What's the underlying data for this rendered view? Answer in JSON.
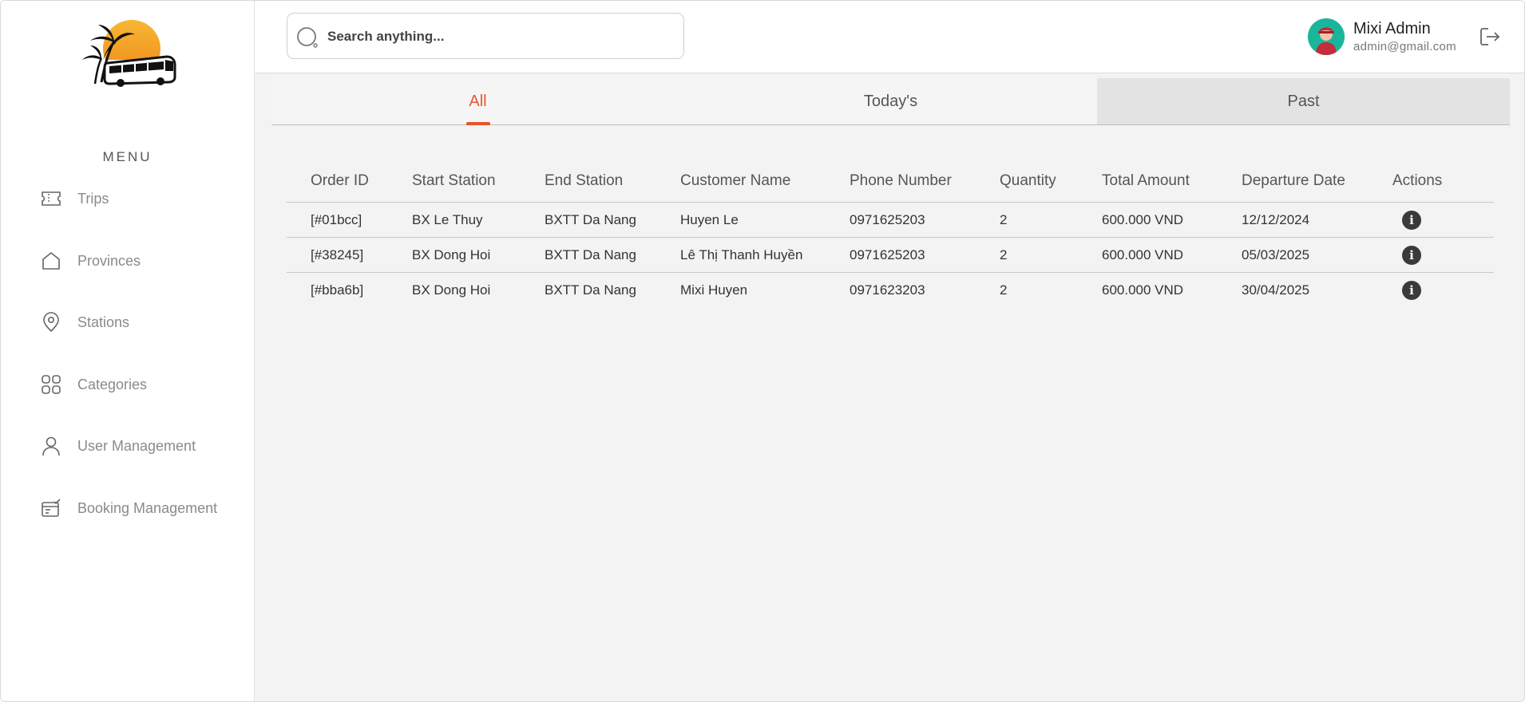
{
  "sidebar": {
    "menu_title": "MENU",
    "items": [
      {
        "label": "Trips",
        "icon": "ticket-icon"
      },
      {
        "label": "Provinces",
        "icon": "home-icon"
      },
      {
        "label": "Stations",
        "icon": "location-pin-icon"
      },
      {
        "label": "Categories",
        "icon": "grid-icon"
      },
      {
        "label": "User Management",
        "icon": "user-icon"
      },
      {
        "label": "Booking Management",
        "icon": "booking-icon"
      }
    ]
  },
  "header": {
    "search_placeholder": "Search anything...",
    "user_name": "Mixi Admin",
    "user_email": "admin@gmail.com"
  },
  "tabs": [
    {
      "label": "All",
      "active": true
    },
    {
      "label": "Today's",
      "active": false
    },
    {
      "label": "Past",
      "active": false
    }
  ],
  "table": {
    "columns": [
      "Order ID",
      "Start Station",
      "End Station",
      "Customer Name",
      "Phone Number",
      "Quantity",
      "Total Amount",
      "Departure Date",
      "Actions"
    ],
    "rows": [
      [
        "[#01bcc]",
        "BX Le Thuy",
        "BXTT Da Nang",
        "Huyen Le",
        "0971625203",
        "2",
        "600.000 VND",
        "12/12/2024"
      ],
      [
        "[#38245]",
        "BX Dong Hoi",
        "BXTT Da Nang",
        "Lê Thị Thanh Huyền",
        "0971625203",
        "2",
        "600.000 VND",
        "05/03/2025"
      ],
      [
        "[#bba6b]",
        "BX Dong Hoi",
        "BXTT Da Nang",
        "Mixi Huyen",
        "0971623203",
        "2",
        "600.000 VND",
        "30/04/2025"
      ]
    ],
    "action_icon": "info-icon"
  },
  "colors": {
    "accent": "#e8542e",
    "sidebar_bg": "#ffffff",
    "content_bg": "#f3f3f3",
    "avatar_bg": "#1ab69c"
  }
}
